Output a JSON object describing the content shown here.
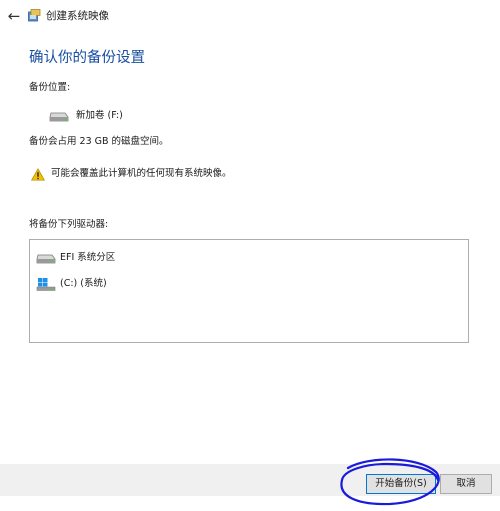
{
  "window": {
    "title": "创建系统映像",
    "back_icon": "←"
  },
  "page": {
    "heading": "确认你的备份设置",
    "location_label": "备份位置:",
    "location_value": "新加卷 (F:)",
    "space_text": "备份会占用 23 GB 的磁盘空间。",
    "warning_text": "可能会覆盖此计算机的任何现有系统映像。",
    "drives_label": "将备份下列驱动器:"
  },
  "drives": [
    {
      "label": "EFI 系统分区",
      "icon": "drive-icon"
    },
    {
      "label": "(C:) (系统)",
      "icon": "windows-drive-icon"
    }
  ],
  "footer": {
    "start_label": "开始备份(S)",
    "cancel_label": "取消"
  },
  "colors": {
    "heading": "#1a4fa0",
    "annotation": "#1a1adc",
    "footer_bg": "#f0f0f0"
  }
}
